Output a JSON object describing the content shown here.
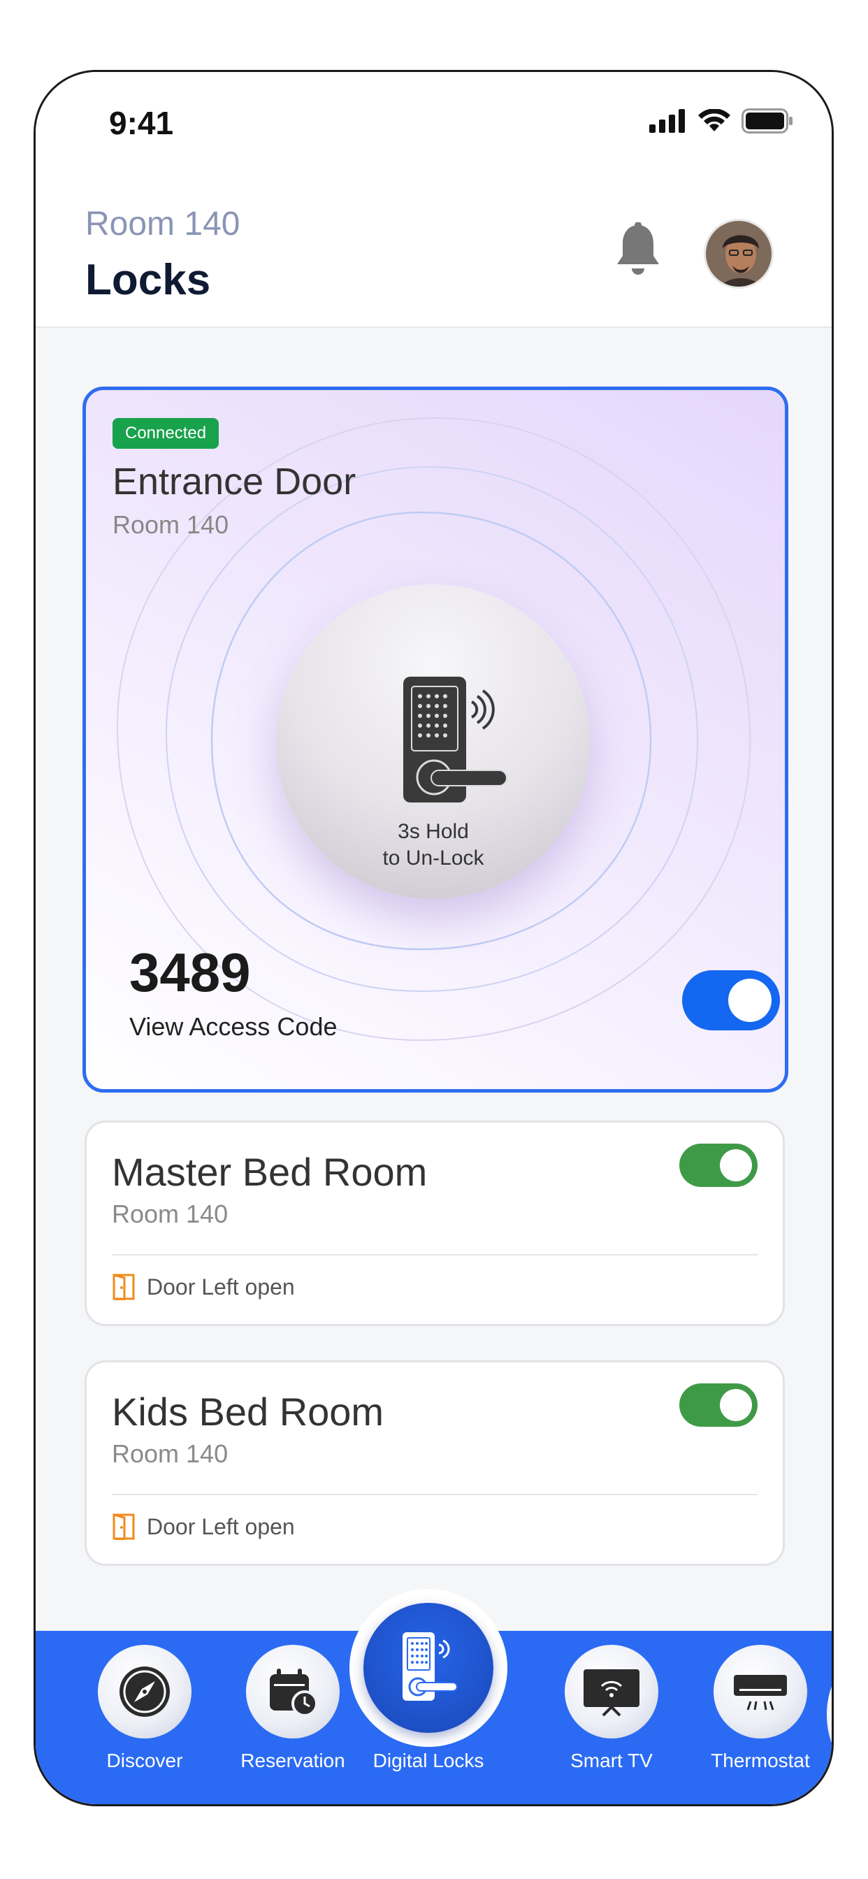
{
  "status_bar": {
    "time": "9:41"
  },
  "header": {
    "room": "Room 140",
    "title": "Locks"
  },
  "main_lock": {
    "badge": "Connected",
    "title": "Entrance Door",
    "room": "Room 140",
    "hint_line1": "3s Hold",
    "hint_line2": "to Un-Lock",
    "code": "3489",
    "code_link": "View Access Code",
    "toggle_on": true
  },
  "rooms": [
    {
      "title": "Master Bed Room",
      "room": "Room 140",
      "status": "Door Left open",
      "toggle_on": true
    },
    {
      "title": "Kids Bed Room",
      "room": "Room 140",
      "status": "Door Left open",
      "toggle_on": true
    }
  ],
  "nav": {
    "items": [
      {
        "label": "Discover",
        "icon": "compass-icon"
      },
      {
        "label": "Reservation",
        "icon": "calendar-clock-icon"
      },
      {
        "label": "Digital Locks",
        "icon": "digital-lock-icon"
      },
      {
        "label": "Smart TV",
        "icon": "smart-tv-icon"
      },
      {
        "label": "Thermostat",
        "icon": "air-conditioner-icon"
      }
    ],
    "active_color": "#2b6bf3"
  },
  "colors": {
    "accent": "#2d6df0",
    "connected": "#18a24c",
    "toggle_green": "#3f9a47",
    "door_icon": "#f08a1c"
  }
}
